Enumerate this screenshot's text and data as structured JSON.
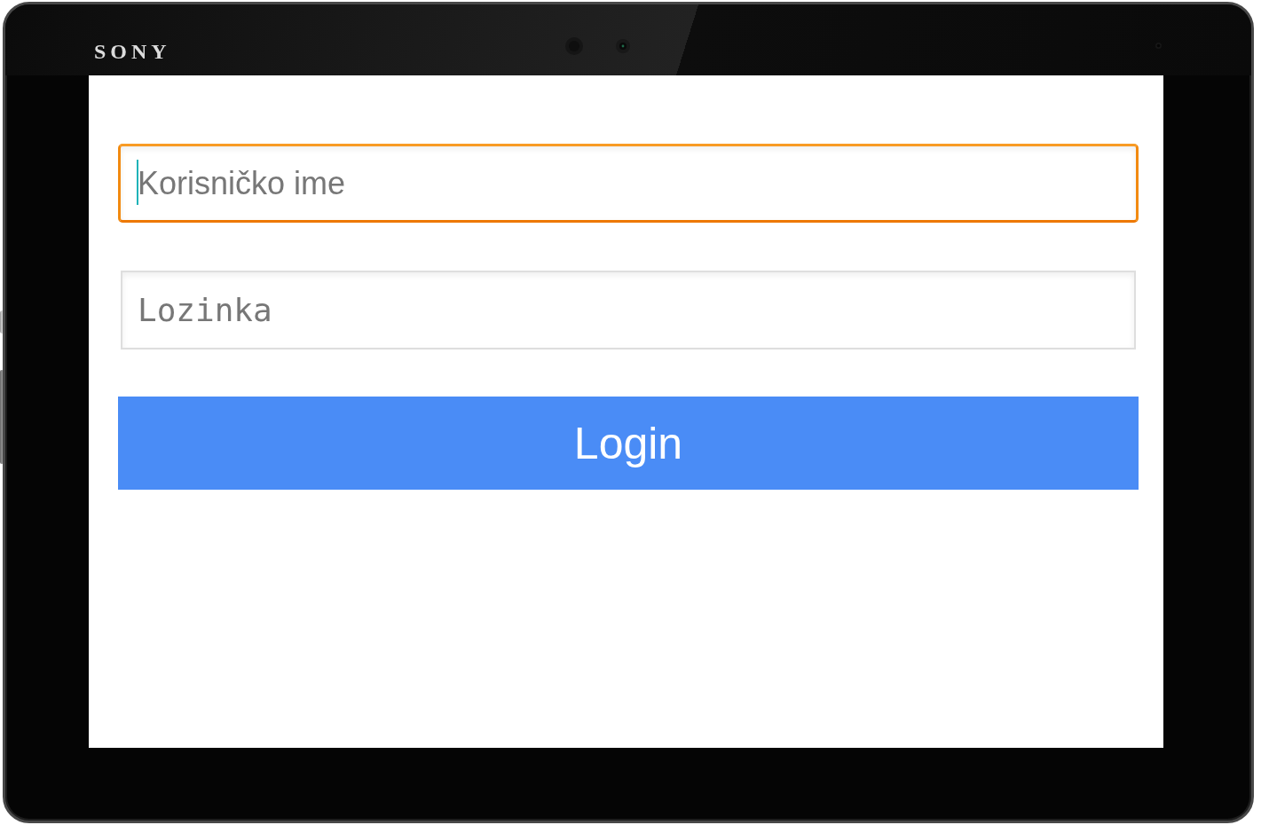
{
  "device": {
    "brand": "SONY"
  },
  "form": {
    "fields": [
      {
        "kind": "text",
        "placeholder": "Korisničko ime",
        "focused": true
      },
      {
        "kind": "password",
        "placeholder": "Lozinka",
        "focused": false
      }
    ],
    "button": {
      "label": "Login"
    }
  }
}
